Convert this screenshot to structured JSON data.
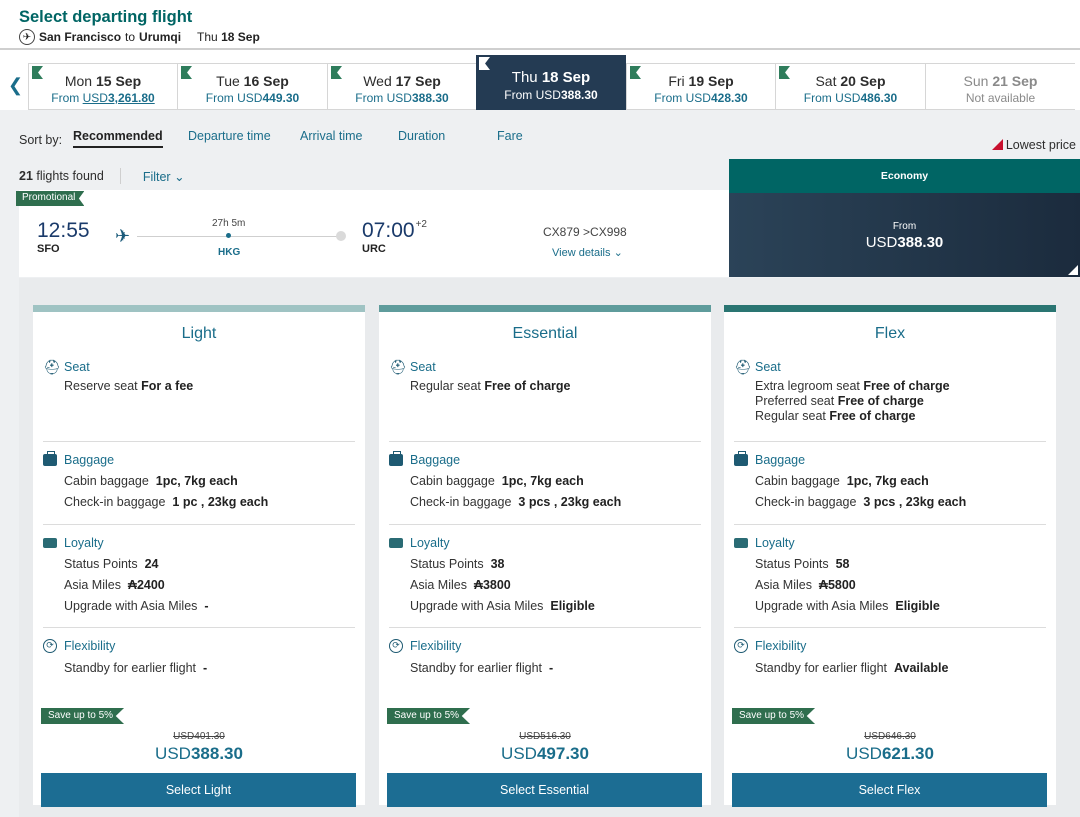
{
  "header": {
    "title": "Select departing flight",
    "origin": "San Francisco",
    "to_word": "to",
    "destination": "Urumqi",
    "date_prefix": "Thu",
    "date": "18 Sep"
  },
  "date_tabs": [
    {
      "dow": "Mon",
      "date": "15 Sep",
      "from": "From",
      "currency": "USD",
      "price": "3,261.80",
      "underlined": true
    },
    {
      "dow": "Tue",
      "date": "16 Sep",
      "from": "From",
      "currency": "USD",
      "price": "449.30"
    },
    {
      "dow": "Wed",
      "date": "17 Sep",
      "from": "From",
      "currency": "USD",
      "price": "388.30"
    },
    {
      "dow": "Thu",
      "date": "18 Sep",
      "from": "From",
      "currency": "USD",
      "price": "388.30",
      "selected": true
    },
    {
      "dow": "Fri",
      "date": "19 Sep",
      "from": "From",
      "currency": "USD",
      "price": "428.30"
    },
    {
      "dow": "Sat",
      "date": "20 Sep",
      "from": "From",
      "currency": "USD",
      "price": "486.30"
    },
    {
      "dow": "Sun",
      "date": "21 Sep",
      "status": "Not available",
      "disabled": true
    }
  ],
  "sort": {
    "label": "Sort by:",
    "options": [
      "Recommended",
      "Departure time",
      "Arrival time",
      "Duration",
      "Fare"
    ],
    "active": "Recommended",
    "lowest_price": "Lowest price"
  },
  "results": {
    "count": "21",
    "count_label": "flights found",
    "filter": "Filter"
  },
  "flight": {
    "promo": "Promotional",
    "dep_time": "12:55",
    "dep_code": "SFO",
    "duration": "27h 5m",
    "stop": "HKG",
    "arr_time": "07:00",
    "arr_offset": "+2",
    "arr_code": "URC",
    "flight_numbers": "CX879 >CX998",
    "view_details": "View details"
  },
  "economy": {
    "label": "Economy",
    "from": "From",
    "currency": "USD",
    "price": "388.30"
  },
  "fares": [
    {
      "name": "Light",
      "bar_color": "#9fc3c3",
      "seat_title": "Seat",
      "seat_lines": [
        {
          "text": "Reserve seat",
          "bold": "For a fee"
        }
      ],
      "baggage_title": "Baggage",
      "cabin_label": "Cabin baggage",
      "cabin_value": "1pc, 7kg each",
      "checkin_label": "Check-in baggage",
      "checkin_value": "1 pc , 23kg each",
      "loyalty_title": "Loyalty",
      "status_label": "Status Points",
      "status_value": "24",
      "miles_label": "Asia Miles",
      "miles_value": "2400",
      "upgrade_label": "Upgrade with Asia Miles",
      "upgrade_value": "-",
      "flex_title": "Flexibility",
      "standby_label": "Standby for earlier flight",
      "standby_value": "-",
      "save": "Save up to 5%",
      "old_price": "USD401.30",
      "currency": "USD",
      "price": "388.30",
      "button": "Select Light"
    },
    {
      "name": "Essential",
      "bar_color": "#5f9c9c",
      "seat_title": "Seat",
      "seat_lines": [
        {
          "text": "Regular seat",
          "bold": "Free of charge"
        }
      ],
      "baggage_title": "Baggage",
      "cabin_label": "Cabin baggage",
      "cabin_value": "1pc, 7kg each",
      "checkin_label": "Check-in baggage",
      "checkin_value": "3 pcs , 23kg each",
      "loyalty_title": "Loyalty",
      "status_label": "Status Points",
      "status_value": "38",
      "miles_label": "Asia Miles",
      "miles_value": "3800",
      "upgrade_label": "Upgrade with Asia Miles",
      "upgrade_value": "Eligible",
      "flex_title": "Flexibility",
      "standby_label": "Standby for earlier flight",
      "standby_value": "-",
      "save": "Save up to 5%",
      "old_price": "USD516.30",
      "currency": "USD",
      "price": "497.30",
      "button": "Select Essential"
    },
    {
      "name": "Flex",
      "bar_color": "#2a7572",
      "seat_title": "Seat",
      "seat_lines": [
        {
          "text": "Extra legroom seat",
          "bold": "Free of charge"
        },
        {
          "text": "Preferred seat",
          "bold": "Free of charge"
        },
        {
          "text": "Regular seat",
          "bold": "Free of charge"
        }
      ],
      "baggage_title": "Baggage",
      "cabin_label": "Cabin baggage",
      "cabin_value": "1pc, 7kg each",
      "checkin_label": "Check-in baggage",
      "checkin_value": "3 pcs , 23kg each",
      "loyalty_title": "Loyalty",
      "status_label": "Status Points",
      "status_value": "58",
      "miles_label": "Asia Miles",
      "miles_value": "5800",
      "upgrade_label": "Upgrade with Asia Miles",
      "upgrade_value": "Eligible",
      "flex_title": "Flexibility",
      "standby_label": "Standby for earlier flight",
      "standby_value": "Available",
      "save": "Save up to 5%",
      "old_price": "USD646.30",
      "currency": "USD",
      "price": "621.30",
      "button": "Select Flex"
    }
  ],
  "icons": {
    "route_plane": "airplane-icon",
    "prev": "chevron-left-icon",
    "seat": "seat-icon",
    "baggage": "baggage-icon",
    "loyalty": "loyalty-card-icon",
    "flexibility": "flexibility-icon",
    "miles": "asia-miles-icon"
  }
}
